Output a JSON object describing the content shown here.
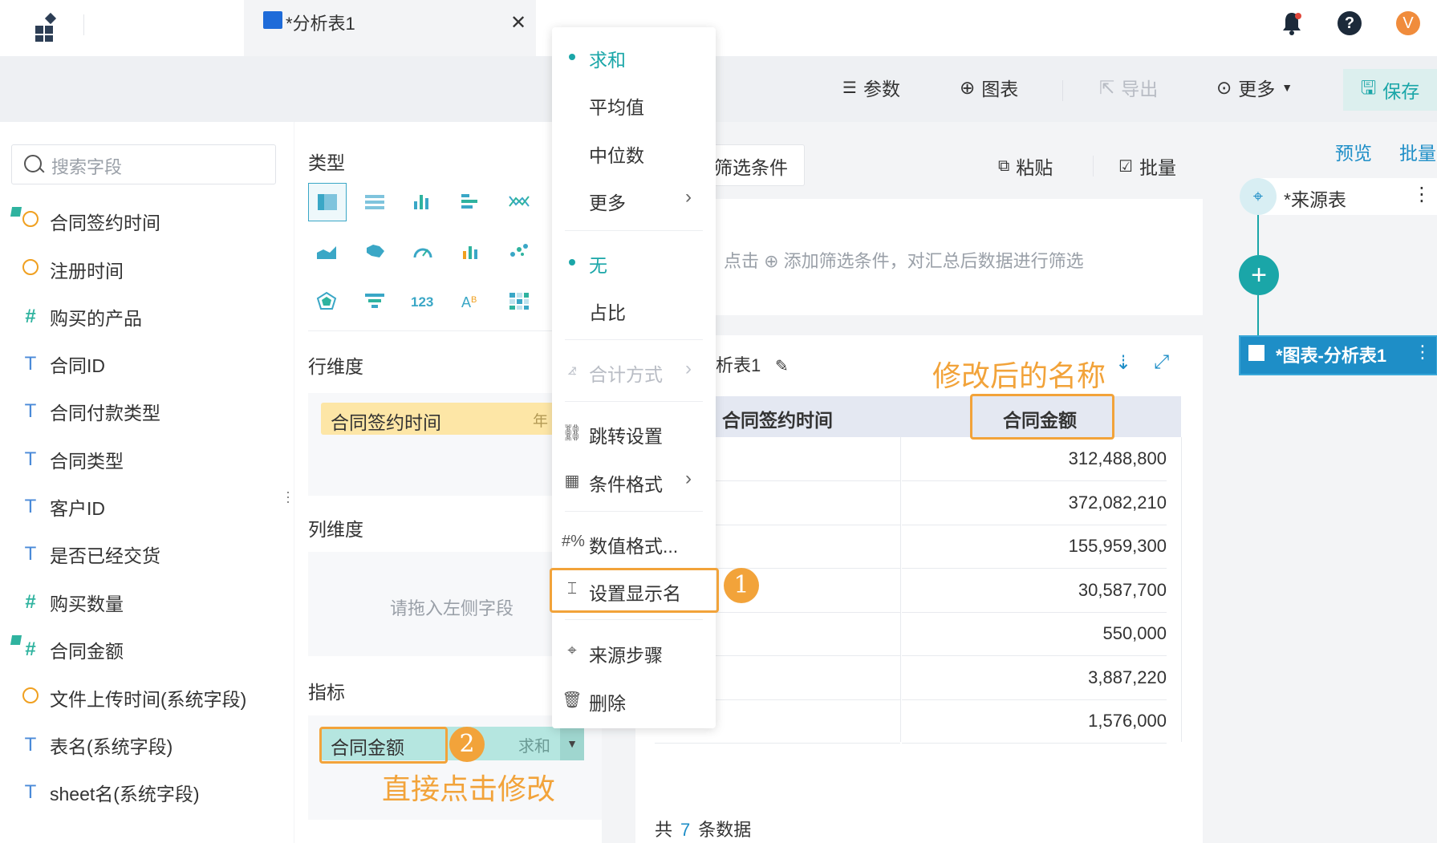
{
  "tab": {
    "title": "*分析表1"
  },
  "top_icons": {
    "help": "?",
    "avatar": "V"
  },
  "toolbar": {
    "params": "参数",
    "chart": "图表",
    "export": "导出",
    "more": "更多",
    "save": "保存"
  },
  "search": {
    "placeholder": "搜索字段"
  },
  "fields": [
    {
      "type": "date",
      "label": "合同签约时间"
    },
    {
      "type": "date",
      "label": "注册时间"
    },
    {
      "type": "number",
      "label": "购买的产品"
    },
    {
      "type": "text",
      "label": "合同ID"
    },
    {
      "type": "text",
      "label": "合同付款类型"
    },
    {
      "type": "text",
      "label": "合同类型"
    },
    {
      "type": "text",
      "label": "客户ID"
    },
    {
      "type": "text",
      "label": "是否已经交货"
    },
    {
      "type": "number",
      "label": "购买数量"
    },
    {
      "type": "number",
      "label": "合同金额"
    },
    {
      "type": "date",
      "label": "文件上传时间(系统字段)"
    },
    {
      "type": "text",
      "label": "表名(系统字段)"
    },
    {
      "type": "text",
      "label": "sheet名(系统字段)"
    }
  ],
  "config": {
    "type_title": "类型",
    "row_title": "行维度",
    "col_title": "列维度",
    "metric_title": "指标",
    "row_pill": {
      "label": "合同签约时间",
      "suffix": "年"
    },
    "col_placeholder": "请拖入左侧字段",
    "metric_pill": {
      "label": "合同金额",
      "agg": "求和"
    },
    "annotation_num": "2",
    "annotation_text": "直接点击修改"
  },
  "main": {
    "filter_tab": "筛选条件",
    "paste": "粘贴",
    "batch": "批量",
    "filter_hint": "点击 ⊕ 添加筛选条件，对汇总后数据进行筛选",
    "table_title": "析表1",
    "modified_name_note": "修改后的名称",
    "headers": [
      "合同签约时间",
      "合同金额"
    ],
    "rows": [
      "312,488,800",
      "372,082,210",
      "155,959,300",
      "30,587,700",
      "550,000",
      "3,887,220",
      "1,576,000"
    ],
    "total_prefix": "共",
    "total_count": "7",
    "total_suffix": "条数据"
  },
  "flow": {
    "preview": "预览",
    "batch": "批量",
    "source": "*来源表",
    "chart": "*图表-分析表1"
  },
  "menu": {
    "agg": [
      "求和",
      "平均值",
      "中位数",
      "更多"
    ],
    "agg_selected": "求和",
    "ratio": [
      "无",
      "占比"
    ],
    "ratio_selected": "无",
    "total_method": "合计方式",
    "jump": "跳转设置",
    "cond_format": "条件格式",
    "num_format": "数值格式...",
    "set_display": "设置显示名",
    "source_step": "来源步骤",
    "delete": "删除",
    "annotation_num": "1"
  },
  "colors": {
    "accent": "#1aa6a8",
    "annotation": "#f2a33a",
    "link": "#1e8ec7"
  }
}
